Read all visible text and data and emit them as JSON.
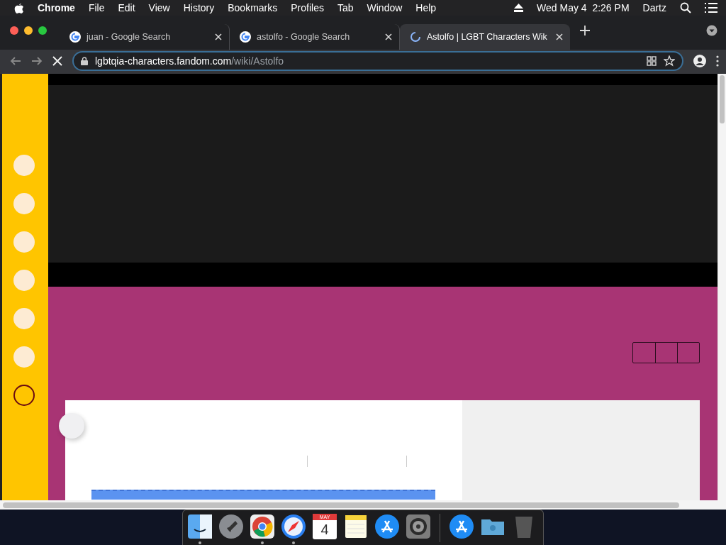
{
  "menubar": {
    "app": "Chrome",
    "menus": [
      "File",
      "Edit",
      "View",
      "History",
      "Bookmarks",
      "Profiles",
      "Tab",
      "Window",
      "Help"
    ],
    "clock": "Wed May 4  2:26 PM",
    "user": "Dartz"
  },
  "tabs": [
    {
      "title": "juan - Google Search",
      "selected": false,
      "loading": false
    },
    {
      "title": "astolfo - Google Search",
      "selected": false,
      "loading": false
    },
    {
      "title": "Astolfo | LGBT Characters Wik",
      "selected": true,
      "loading": true
    }
  ],
  "toolbar": {
    "loading": true,
    "host": "lgbtqia-characters.fandom.com",
    "path": "/wiki/Astolfo"
  },
  "sidebar_dots": [
    {
      "filled": true
    },
    {
      "filled": true
    },
    {
      "filled": true
    },
    {
      "filled": true
    },
    {
      "filled": true
    },
    {
      "filled": true
    },
    {
      "filled": false
    }
  ],
  "dock": [
    {
      "kind": "finder",
      "running": true
    },
    {
      "kind": "launchpad",
      "running": false
    },
    {
      "kind": "chrome",
      "running": true
    },
    {
      "kind": "safari",
      "running": true
    },
    {
      "kind": "calendar",
      "running": false,
      "month": "MAY",
      "day": "4"
    },
    {
      "kind": "notes",
      "running": false
    },
    {
      "kind": "appstore",
      "running": false
    },
    {
      "kind": "settings",
      "running": false
    },
    {
      "kind": "separator"
    },
    {
      "kind": "appstore",
      "running": false
    },
    {
      "kind": "folder",
      "running": false
    },
    {
      "kind": "trash",
      "running": false
    }
  ]
}
